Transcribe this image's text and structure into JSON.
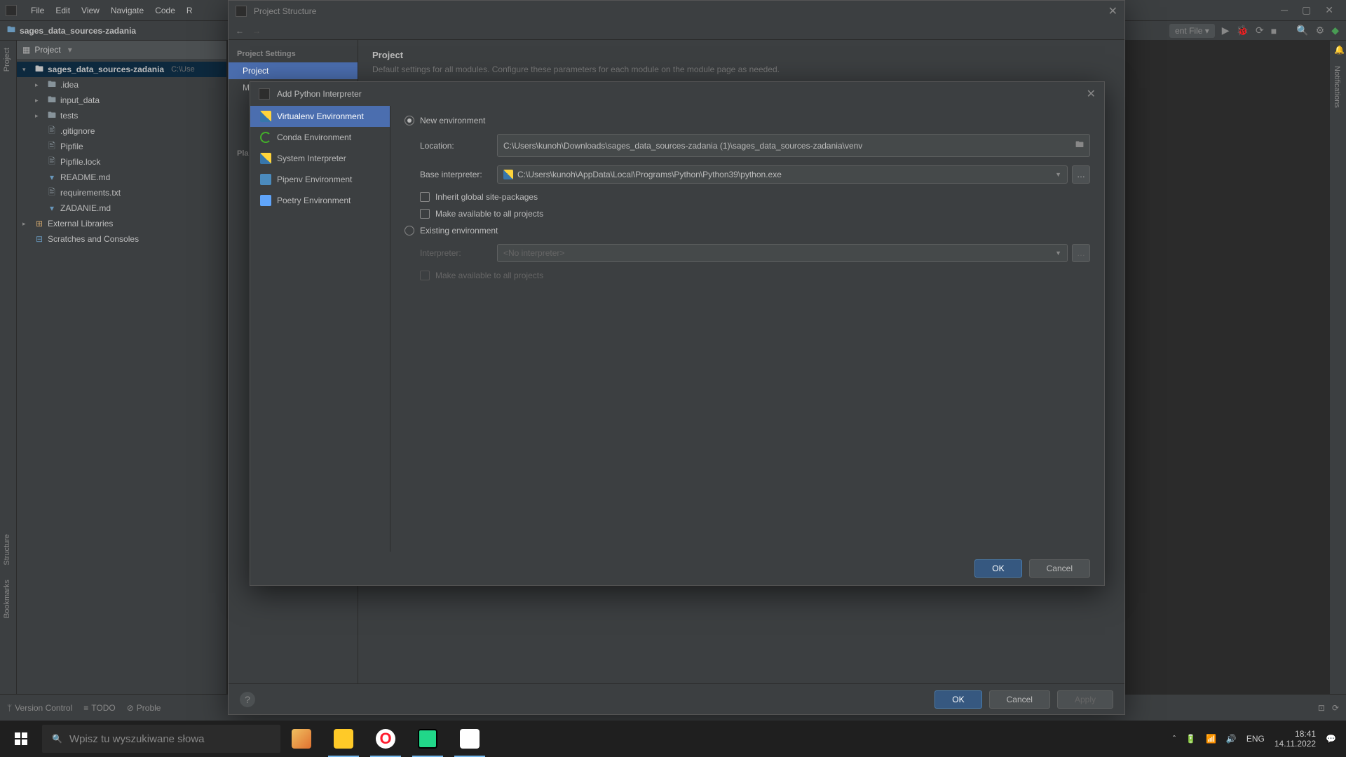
{
  "menubar": [
    "File",
    "Edit",
    "View",
    "Navigate",
    "Code",
    "R"
  ],
  "breadcrumb": "sages_data_sources-zadania",
  "toolbar_dropdown": "ent File",
  "project_panel_title": "Project",
  "tree": {
    "root": "sages_data_sources-zadania",
    "root_path": "C:\\Use",
    "children": [
      {
        "type": "folder",
        "label": ".idea"
      },
      {
        "type": "folder",
        "label": "input_data"
      },
      {
        "type": "folder",
        "label": "tests"
      },
      {
        "type": "file",
        "label": ".gitignore"
      },
      {
        "type": "file",
        "label": "Pipfile"
      },
      {
        "type": "file",
        "label": "Pipfile.lock"
      },
      {
        "type": "md",
        "label": "README.md"
      },
      {
        "type": "file",
        "label": "requirements.txt"
      },
      {
        "type": "md",
        "label": "ZADANIE.md"
      }
    ],
    "external": "External Libraries",
    "scratches": "Scratches and Consoles"
  },
  "ps_modal": {
    "title": "Project Structure",
    "section": "Project Settings",
    "items": [
      "Project",
      "Modules"
    ],
    "platform_section": "Pla",
    "content_title": "Project",
    "content_desc": "Default settings for all modules. Configure these parameters for each module on the module page as needed.",
    "buttons": {
      "ok": "OK",
      "cancel": "Cancel",
      "apply": "Apply"
    }
  },
  "interp_modal": {
    "title": "Add Python Interpreter",
    "options": [
      "Virtualenv Environment",
      "Conda Environment",
      "System Interpreter",
      "Pipenv Environment",
      "Poetry Environment"
    ],
    "new_env_label": "New environment",
    "existing_env_label": "Existing environment",
    "location_label": "Location:",
    "location_value": "C:\\Users\\kunoh\\Downloads\\sages_data_sources-zadania (1)\\sages_data_sources-zadania\\venv",
    "base_label": "Base interpreter:",
    "base_value": "C:\\Users\\kunoh\\AppData\\Local\\Programs\\Python\\Python39\\python.exe",
    "inherit_label": "Inherit global site-packages",
    "avail_label": "Make available to all projects",
    "interpreter_label": "Interpreter:",
    "interpreter_placeholder": "<No interpreter>",
    "avail_label2": "Make available to all projects",
    "buttons": {
      "ok": "OK",
      "cancel": "Cancel"
    }
  },
  "status": {
    "vcs": "Version Control",
    "todo": "TODO",
    "problems": "Proble"
  },
  "left_tabs": {
    "project": "Project",
    "structure": "Structure",
    "bookmarks": "Bookmarks"
  },
  "right_tabs": {
    "notifications": "Notifications"
  },
  "taskbar": {
    "search_placeholder": "Wpisz tu wyszukiwane słowa",
    "lang": "ENG",
    "time": "18:41",
    "date": "14.11.2022"
  }
}
